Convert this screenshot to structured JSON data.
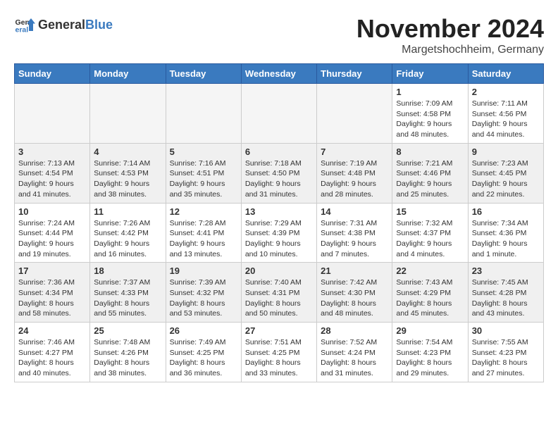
{
  "logo": {
    "text_general": "General",
    "text_blue": "Blue"
  },
  "title": "November 2024",
  "location": "Margetshochheim, Germany",
  "days_of_week": [
    "Sunday",
    "Monday",
    "Tuesday",
    "Wednesday",
    "Thursday",
    "Friday",
    "Saturday"
  ],
  "weeks": [
    [
      {
        "day": "",
        "info": "",
        "empty": true
      },
      {
        "day": "",
        "info": "",
        "empty": true
      },
      {
        "day": "",
        "info": "",
        "empty": true
      },
      {
        "day": "",
        "info": "",
        "empty": true
      },
      {
        "day": "",
        "info": "",
        "empty": true
      },
      {
        "day": "1",
        "info": "Sunrise: 7:09 AM\nSunset: 4:58 PM\nDaylight: 9 hours\nand 48 minutes."
      },
      {
        "day": "2",
        "info": "Sunrise: 7:11 AM\nSunset: 4:56 PM\nDaylight: 9 hours\nand 44 minutes."
      }
    ],
    [
      {
        "day": "3",
        "info": "Sunrise: 7:13 AM\nSunset: 4:54 PM\nDaylight: 9 hours\nand 41 minutes."
      },
      {
        "day": "4",
        "info": "Sunrise: 7:14 AM\nSunset: 4:53 PM\nDaylight: 9 hours\nand 38 minutes."
      },
      {
        "day": "5",
        "info": "Sunrise: 7:16 AM\nSunset: 4:51 PM\nDaylight: 9 hours\nand 35 minutes."
      },
      {
        "day": "6",
        "info": "Sunrise: 7:18 AM\nSunset: 4:50 PM\nDaylight: 9 hours\nand 31 minutes."
      },
      {
        "day": "7",
        "info": "Sunrise: 7:19 AM\nSunset: 4:48 PM\nDaylight: 9 hours\nand 28 minutes."
      },
      {
        "day": "8",
        "info": "Sunrise: 7:21 AM\nSunset: 4:46 PM\nDaylight: 9 hours\nand 25 minutes."
      },
      {
        "day": "9",
        "info": "Sunrise: 7:23 AM\nSunset: 4:45 PM\nDaylight: 9 hours\nand 22 minutes."
      }
    ],
    [
      {
        "day": "10",
        "info": "Sunrise: 7:24 AM\nSunset: 4:44 PM\nDaylight: 9 hours\nand 19 minutes."
      },
      {
        "day": "11",
        "info": "Sunrise: 7:26 AM\nSunset: 4:42 PM\nDaylight: 9 hours\nand 16 minutes."
      },
      {
        "day": "12",
        "info": "Sunrise: 7:28 AM\nSunset: 4:41 PM\nDaylight: 9 hours\nand 13 minutes."
      },
      {
        "day": "13",
        "info": "Sunrise: 7:29 AM\nSunset: 4:39 PM\nDaylight: 9 hours\nand 10 minutes."
      },
      {
        "day": "14",
        "info": "Sunrise: 7:31 AM\nSunset: 4:38 PM\nDaylight: 9 hours\nand 7 minutes."
      },
      {
        "day": "15",
        "info": "Sunrise: 7:32 AM\nSunset: 4:37 PM\nDaylight: 9 hours\nand 4 minutes."
      },
      {
        "day": "16",
        "info": "Sunrise: 7:34 AM\nSunset: 4:36 PM\nDaylight: 9 hours\nand 1 minute."
      }
    ],
    [
      {
        "day": "17",
        "info": "Sunrise: 7:36 AM\nSunset: 4:34 PM\nDaylight: 8 hours\nand 58 minutes."
      },
      {
        "day": "18",
        "info": "Sunrise: 7:37 AM\nSunset: 4:33 PM\nDaylight: 8 hours\nand 55 minutes."
      },
      {
        "day": "19",
        "info": "Sunrise: 7:39 AM\nSunset: 4:32 PM\nDaylight: 8 hours\nand 53 minutes."
      },
      {
        "day": "20",
        "info": "Sunrise: 7:40 AM\nSunset: 4:31 PM\nDaylight: 8 hours\nand 50 minutes."
      },
      {
        "day": "21",
        "info": "Sunrise: 7:42 AM\nSunset: 4:30 PM\nDaylight: 8 hours\nand 48 minutes."
      },
      {
        "day": "22",
        "info": "Sunrise: 7:43 AM\nSunset: 4:29 PM\nDaylight: 8 hours\nand 45 minutes."
      },
      {
        "day": "23",
        "info": "Sunrise: 7:45 AM\nSunset: 4:28 PM\nDaylight: 8 hours\nand 43 minutes."
      }
    ],
    [
      {
        "day": "24",
        "info": "Sunrise: 7:46 AM\nSunset: 4:27 PM\nDaylight: 8 hours\nand 40 minutes."
      },
      {
        "day": "25",
        "info": "Sunrise: 7:48 AM\nSunset: 4:26 PM\nDaylight: 8 hours\nand 38 minutes."
      },
      {
        "day": "26",
        "info": "Sunrise: 7:49 AM\nSunset: 4:25 PM\nDaylight: 8 hours\nand 36 minutes."
      },
      {
        "day": "27",
        "info": "Sunrise: 7:51 AM\nSunset: 4:25 PM\nDaylight: 8 hours\nand 33 minutes."
      },
      {
        "day": "28",
        "info": "Sunrise: 7:52 AM\nSunset: 4:24 PM\nDaylight: 8 hours\nand 31 minutes."
      },
      {
        "day": "29",
        "info": "Sunrise: 7:54 AM\nSunset: 4:23 PM\nDaylight: 8 hours\nand 29 minutes."
      },
      {
        "day": "30",
        "info": "Sunrise: 7:55 AM\nSunset: 4:23 PM\nDaylight: 8 hours\nand 27 minutes."
      }
    ]
  ]
}
